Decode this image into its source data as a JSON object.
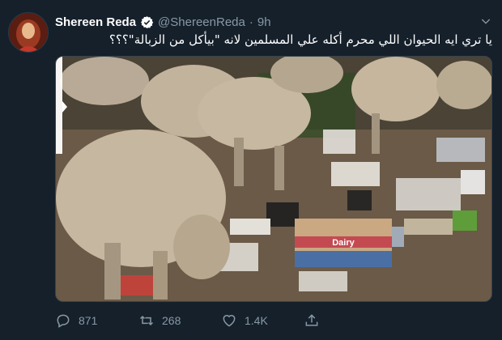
{
  "tweet": {
    "name": "Shereen Reda",
    "handle": "@ShereenReda",
    "separator": "·",
    "time": "9h",
    "text": "يا تري ايه الحيوان اللي محرم أكله علي المسلمين لانه \"بيأكل من الزبالة\"؟؟؟",
    "image_box_text": "Dairy"
  },
  "actions": {
    "replies": "871",
    "retweets": "268",
    "likes": "1.4K"
  },
  "icons": {
    "verified": "verified-badge-icon",
    "caret": "chevron-down-icon",
    "reply": "reply-icon",
    "retweet": "retweet-icon",
    "like": "heart-icon",
    "share": "share-icon"
  },
  "colors": {
    "background": "#15202b",
    "muted": "#8899a6",
    "verified": "#ffffff"
  }
}
